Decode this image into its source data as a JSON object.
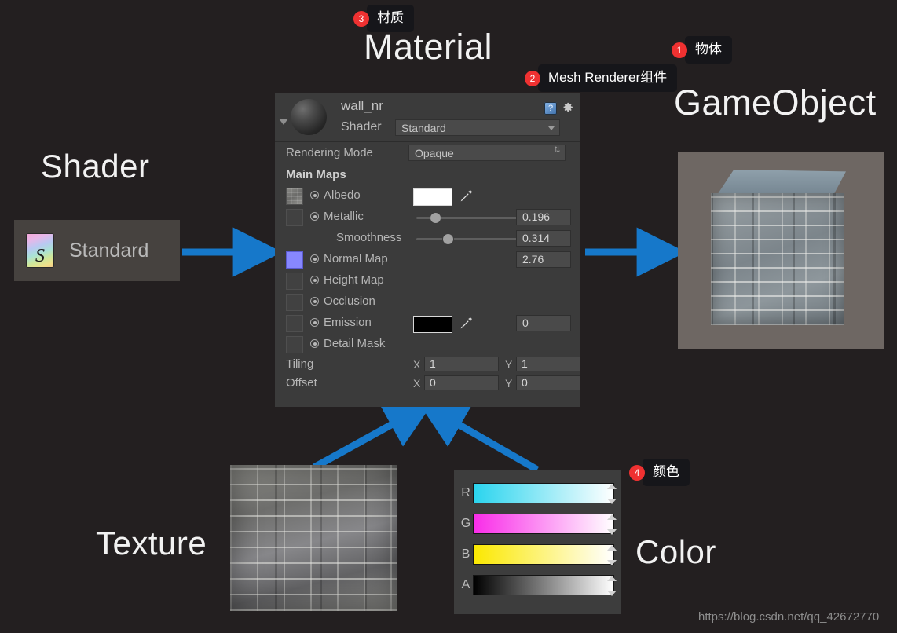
{
  "background_color": "#231f20",
  "accent_arrow_color": "#1678ca",
  "badge_color": "#ef3131",
  "diagram_labels": {
    "material": "Material",
    "gameobject": "GameObject",
    "shader": "Shader",
    "texture": "Texture",
    "color": "Color"
  },
  "annotations": [
    {
      "number": "1",
      "text": "物体"
    },
    {
      "number": "2",
      "text": "Mesh Renderer组件"
    },
    {
      "number": "3",
      "text": "材质"
    },
    {
      "number": "4",
      "text": "颜色"
    }
  ],
  "shader_asset": {
    "icon": "shader-file-icon",
    "name": "Standard"
  },
  "inspector": {
    "material_name": "wall_nr",
    "preview_icon": "material-sphere-preview",
    "help_icon": "help-book-icon",
    "gear_icon": "gear-icon",
    "foldout_icon": "foldout-triangle-icon",
    "shader_label": "Shader",
    "shader_value": "Standard",
    "rendering_mode_label": "Rendering Mode",
    "rendering_mode_value": "Opaque",
    "main_maps_header": "Main Maps",
    "maps": [
      {
        "name": "Albedo",
        "thumb": "stone",
        "swatch": "#ffffff",
        "has_eyedropper": true,
        "value": "",
        "slider": null
      },
      {
        "name": "Metallic",
        "thumb": "empty",
        "swatch": null,
        "has_eyedropper": false,
        "value": "0.196",
        "slider": 0.196
      },
      {
        "name": "Smoothness",
        "thumb": null,
        "swatch": null,
        "has_eyedropper": false,
        "value": "0.314",
        "slider": 0.314
      },
      {
        "name": "Normal Map",
        "thumb": "normal",
        "swatch": null,
        "has_eyedropper": false,
        "value": "2.76",
        "slider": null
      },
      {
        "name": "Height Map",
        "thumb": "empty",
        "swatch": null,
        "has_eyedropper": false,
        "value": "",
        "slider": null
      },
      {
        "name": "Occlusion",
        "thumb": "empty",
        "swatch": null,
        "has_eyedropper": false,
        "value": "",
        "slider": null
      },
      {
        "name": "Emission",
        "thumb": "empty",
        "swatch": "#000000",
        "has_eyedropper": true,
        "value": "0",
        "slider": null
      },
      {
        "name": "Detail Mask",
        "thumb": "empty",
        "swatch": null,
        "has_eyedropper": false,
        "value": "",
        "slider": null
      }
    ],
    "tiling": {
      "label": "Tiling",
      "x_axis": "X",
      "x": "1",
      "y_axis": "Y",
      "y": "1"
    },
    "offset": {
      "label": "Offset",
      "x_axis": "X",
      "x": "0",
      "y_axis": "Y",
      "y": "0"
    }
  },
  "color_picker": {
    "channels": [
      {
        "letter": "R",
        "gradient_from": "#2ad4ee",
        "gradient_to": "#ffffff"
      },
      {
        "letter": "G",
        "gradient_from": "#f92ce8",
        "gradient_to": "#ffffff"
      },
      {
        "letter": "B",
        "gradient_from": "#fbe800",
        "gradient_to": "#ffffff"
      },
      {
        "letter": "A",
        "gradient_from": "#000000",
        "gradient_to": "#ffffff"
      }
    ]
  },
  "texture_image": {
    "alt": "stone-brick-wall-texture"
  },
  "gameobject_render": {
    "alt": "stone-textured-cube"
  },
  "watermark": "https://blog.csdn.net/qq_42672770"
}
